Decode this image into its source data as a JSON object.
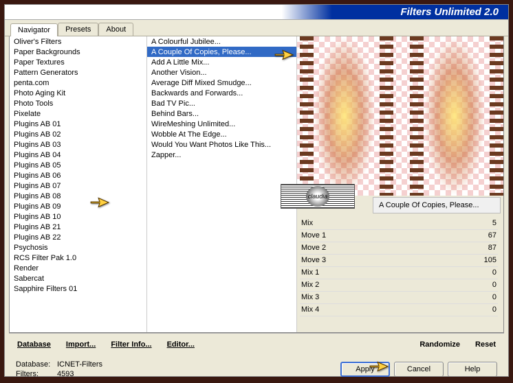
{
  "title": "Filters Unlimited 2.0",
  "tabs": [
    "Navigator",
    "Presets",
    "About"
  ],
  "active_tab": 0,
  "left_list": [
    "Oliver's Filters",
    "Paper Backgrounds",
    "Paper Textures",
    "Pattern Generators",
    "penta.com",
    "Photo Aging Kit",
    "Photo Tools",
    "Pixelate",
    "Plugins AB 01",
    "Plugins AB 02",
    "Plugins AB 03",
    "Plugins AB 04",
    "Plugins AB 05",
    "Plugins AB 06",
    "Plugins AB 07",
    "Plugins AB 08",
    "Plugins AB 09",
    "Plugins AB 10",
    "Plugins AB 21",
    "Plugins AB 22",
    "Psychosis",
    "RCS Filter Pak 1.0",
    "Render",
    "Sabercat",
    "Sapphire Filters 01"
  ],
  "left_selected_index": 15,
  "mid_list": [
    "A Colourful Jubilee...",
    "A Couple Of Copies, Please...",
    "Add A Little Mix...",
    "Another Vision...",
    "Average Diff Mixed Smudge...",
    "Backwards and Forwards...",
    "Bad TV Pic...",
    "Behind Bars...",
    "WireMeshing Unlimited...",
    "Wobble At The Edge...",
    "Would You Want Photos Like This...",
    "Zapper..."
  ],
  "mid_selected_index": 1,
  "selected_filter_name": "A Couple Of Copies, Please...",
  "logo_text": "claudia",
  "params": [
    {
      "label": "Mix",
      "value": 5
    },
    {
      "label": "Move 1",
      "value": 67
    },
    {
      "label": "Move 2",
      "value": 87
    },
    {
      "label": "Move 3",
      "value": 105
    },
    {
      "label": "Mix 1",
      "value": 0
    },
    {
      "label": "Mix 2",
      "value": 0
    },
    {
      "label": "Mix 3",
      "value": 0
    },
    {
      "label": "Mix 4",
      "value": 0
    }
  ],
  "btnbar": {
    "database": "Database",
    "import": "Import...",
    "filter_info": "Filter Info...",
    "editor": "Editor...",
    "randomize": "Randomize",
    "reset": "Reset"
  },
  "footer": {
    "db_label": "Database:",
    "db_value": "ICNET-Filters",
    "filters_label": "Filters:",
    "filters_value": "4593",
    "apply": "Apply",
    "cancel": "Cancel",
    "help": "Help"
  }
}
